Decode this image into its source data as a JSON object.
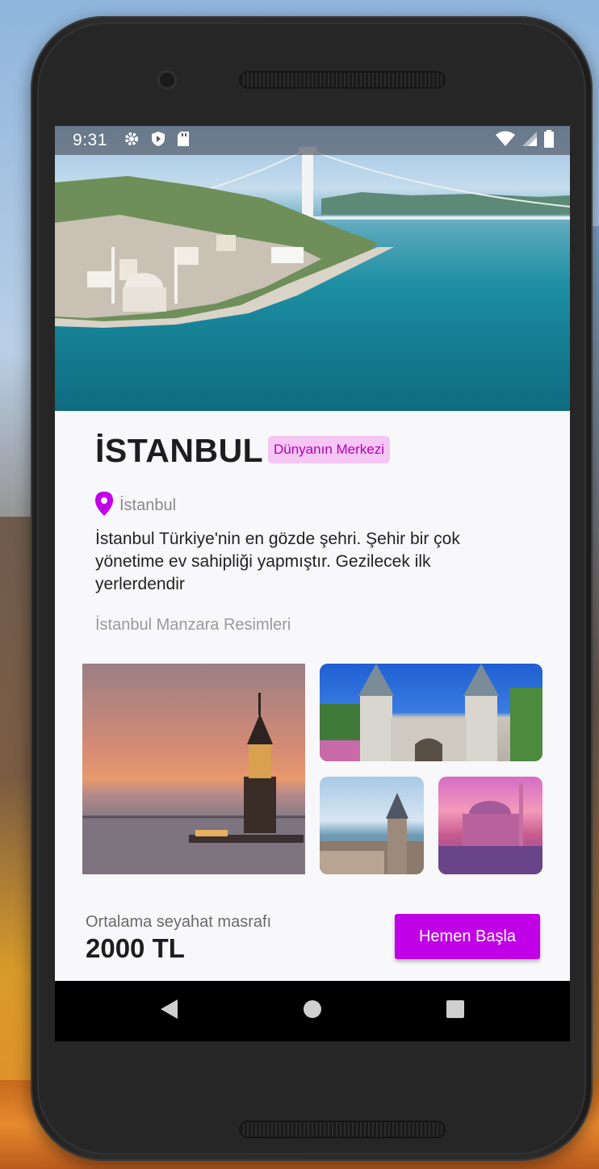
{
  "status_bar": {
    "time": "9:31",
    "icons": [
      "gear-icon",
      "shield-icon",
      "sd-card-icon",
      "wifi-icon",
      "signal-icon",
      "battery-icon"
    ]
  },
  "place": {
    "title": "İSTANBUL",
    "tag": "Dünyanın Merkezi",
    "location": "İstanbul",
    "description": "İstanbul Türkiye'nin en gözde şehri. Şehir bir çok yönetime ev sahipliği yapmıştır. Gezilecek ilk yerlerdendir",
    "gallery_title": "İstanbul Manzara Resimleri"
  },
  "footer": {
    "cost_label": "Ortalama seyahat masrafı",
    "cost_value": "2000 TL",
    "start_button": "Hemen Başla"
  },
  "colors": {
    "accent": "#c000e6",
    "tag_bg": "#f5c6f4",
    "tag_text": "#b000b5"
  }
}
